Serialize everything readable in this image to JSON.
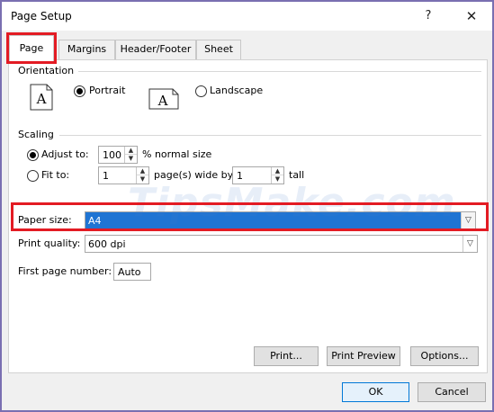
{
  "window": {
    "title": "Page Setup",
    "help_glyph": "?",
    "close_glyph": "✕"
  },
  "tabs": [
    {
      "label": "Page",
      "active": true
    },
    {
      "label": "Margins",
      "active": false
    },
    {
      "label": "Header/Footer",
      "active": false
    },
    {
      "label": "Sheet",
      "active": false
    }
  ],
  "orientation": {
    "label": "Orientation",
    "portrait_label": "Portrait",
    "portrait_selected": true,
    "landscape_label": "Landscape",
    "landscape_selected": false,
    "icon_letter": "A"
  },
  "scaling": {
    "label": "Scaling",
    "adjust_to_label": "Adjust to:",
    "adjust_to_selected": true,
    "adjust_to_value": "100",
    "adjust_to_suffix": "% normal size",
    "fit_to_label": "Fit to:",
    "fit_to_selected": false,
    "fit_wide_value": "1",
    "fit_wide_suffix": "page(s) wide by",
    "fit_tall_value": "1",
    "fit_tall_suffix": "tall"
  },
  "paper_size": {
    "label": "Paper size:",
    "value": "A4"
  },
  "print_quality": {
    "label": "Print quality:",
    "value": "600 dpi"
  },
  "first_page_number": {
    "label": "First page number:",
    "value": "Auto"
  },
  "buttons": {
    "print": "Print...",
    "print_preview": "Print Preview",
    "options": "Options...",
    "ok": "OK",
    "cancel": "Cancel"
  },
  "watermark": "TipsMake.com",
  "colors": {
    "highlight_red": "#e31b23",
    "selection_blue": "#1f74d3",
    "border_purple": "#7a6fb1"
  }
}
